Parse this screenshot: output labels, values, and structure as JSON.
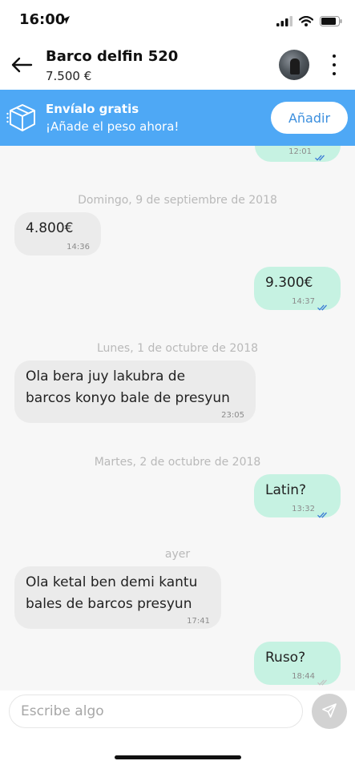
{
  "status_bar": {
    "time": "16:00"
  },
  "header": {
    "title": "Barco delfin 520",
    "price": "7.500 €"
  },
  "banner": {
    "title": "Envíalo gratis",
    "subtitle": "¡Añade el peso ahora!",
    "button_label": "Añadir"
  },
  "messages": [
    {
      "kind": "out",
      "time": "12:01",
      "read": true
    },
    {
      "kind": "date",
      "label": "Domingo, 9 de septiembre de 2018"
    },
    {
      "kind": "in",
      "text": "4.800€",
      "time": "14:36"
    },
    {
      "kind": "out",
      "text": "9.300€",
      "time": "14:37",
      "read": true
    },
    {
      "kind": "date",
      "label": "Lunes, 1 de octubre de 2018"
    },
    {
      "kind": "in",
      "lines": [
        "Ola bera juy lakubra de",
        "barcos konyo bale de presyun"
      ],
      "time": "23:05"
    },
    {
      "kind": "date",
      "label": "Martes, 2 de octubre de 2018"
    },
    {
      "kind": "out",
      "text": "Latin?",
      "time": "13:32",
      "read": true
    },
    {
      "kind": "date",
      "label": "ayer"
    },
    {
      "kind": "in",
      "lines": [
        "Ola ketal ben demi kantu",
        "bales de barcos presyun"
      ],
      "time": "17:41"
    },
    {
      "kind": "out",
      "text": "Ruso?",
      "time": "18:44",
      "read": false
    }
  ],
  "composer": {
    "placeholder": "Escribe algo"
  },
  "colors": {
    "banner": "#4ea8f5",
    "incoming_bubble": "#ebebeb",
    "outgoing_bubble": "#c6f2e2",
    "read_ticks": "#3a7bd5",
    "unread_ticks": "#c4c4c4"
  },
  "icons": [
    "location-arrow-icon",
    "signal-icon",
    "wifi-icon",
    "battery-icon",
    "back-arrow-icon",
    "more-vertical-icon",
    "package-icon",
    "double-check-icon",
    "send-icon"
  ]
}
